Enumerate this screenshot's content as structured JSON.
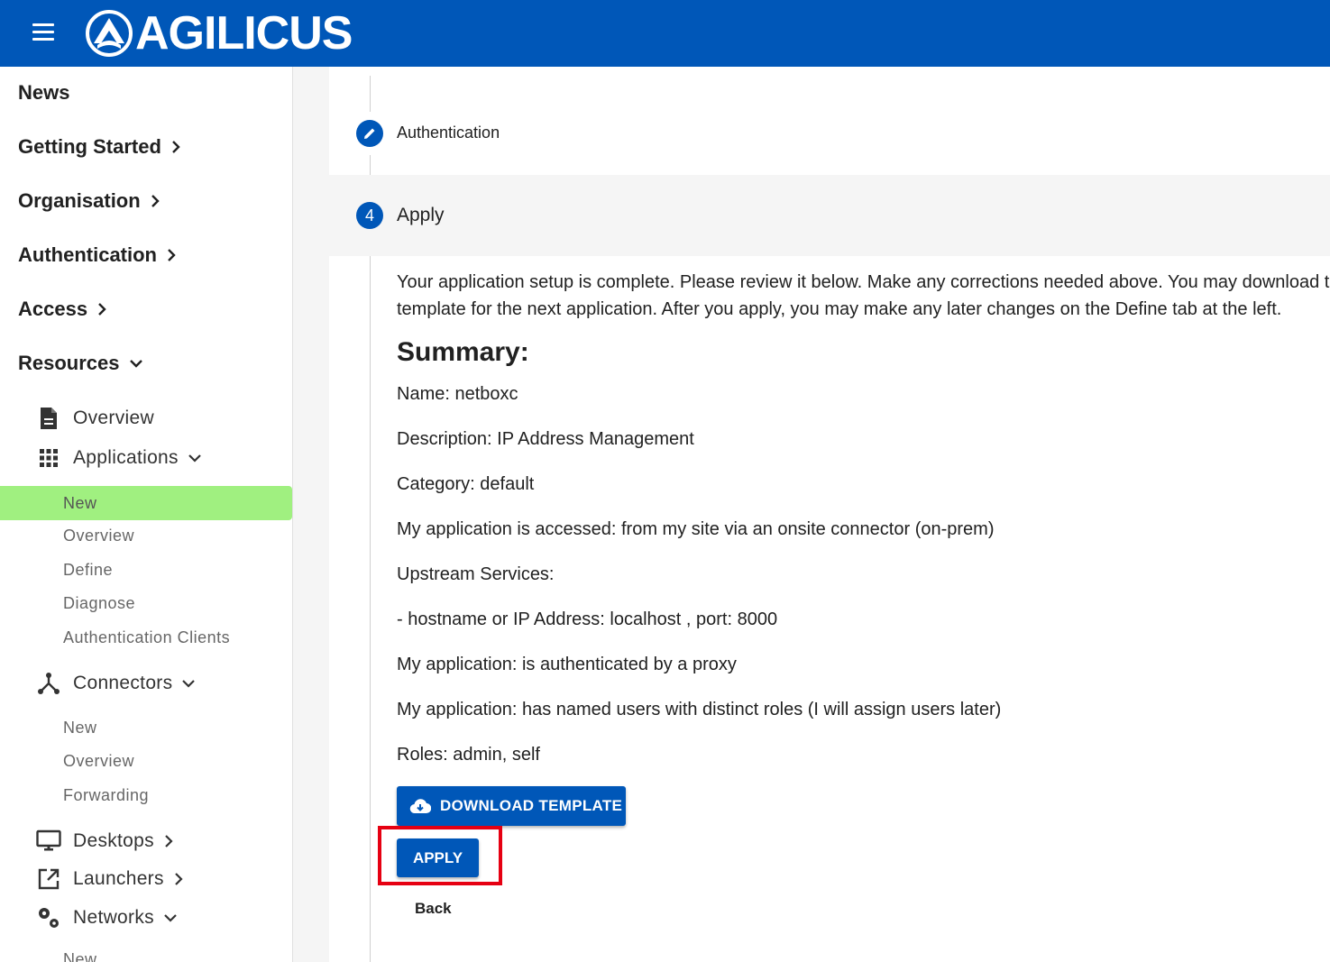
{
  "header": {
    "brand": "AGILICUS",
    "menu_icon": "hamburger-menu-icon",
    "colors": {
      "primary": "#0057b8",
      "active_nav": "#a0f080",
      "highlight": "#e60012"
    }
  },
  "sidebar": {
    "top_items": [
      {
        "label": "News"
      },
      {
        "label": "Getting Started"
      },
      {
        "label": "Organisation"
      },
      {
        "label": "Authentication"
      },
      {
        "label": "Access"
      },
      {
        "label": "Resources"
      }
    ],
    "resources": {
      "overview": "Overview",
      "applications": {
        "label": "Applications",
        "items": [
          "New",
          "Overview",
          "Define",
          "Diagnose",
          "Authentication Clients"
        ]
      },
      "connectors": {
        "label": "Connectors",
        "items": [
          "New",
          "Overview",
          "Forwarding"
        ]
      },
      "desktops": "Desktops",
      "launchers": "Launchers",
      "networks": {
        "label": "Networks",
        "items": [
          "New"
        ]
      }
    }
  },
  "stepper": {
    "step3": {
      "label": "Authentication"
    },
    "step4": {
      "number": "4",
      "label": "Apply"
    }
  },
  "apply": {
    "intro_line1": "Your application setup is complete. Please review it below. Make any corrections needed above. You may download the",
    "intro_line2": "template for the next application. After you apply, you may make any later changes on the Define tab at the left.",
    "summary_title": "Summary:",
    "summary_lines": [
      "Name: netboxc",
      "Description: IP Address Management",
      "Category: default",
      "My application is accessed: from my site via an onsite connector (on-prem)",
      "Upstream Services:",
      "- hostname or IP Address: localhost , port: 8000",
      "My application: is authenticated by a proxy",
      "My application: has named users with distinct roles (I will assign users later)",
      "Roles: admin, self"
    ],
    "download_label": "DOWNLOAD TEMPLATE",
    "apply_label": "APPLY",
    "back_label": "Back"
  }
}
